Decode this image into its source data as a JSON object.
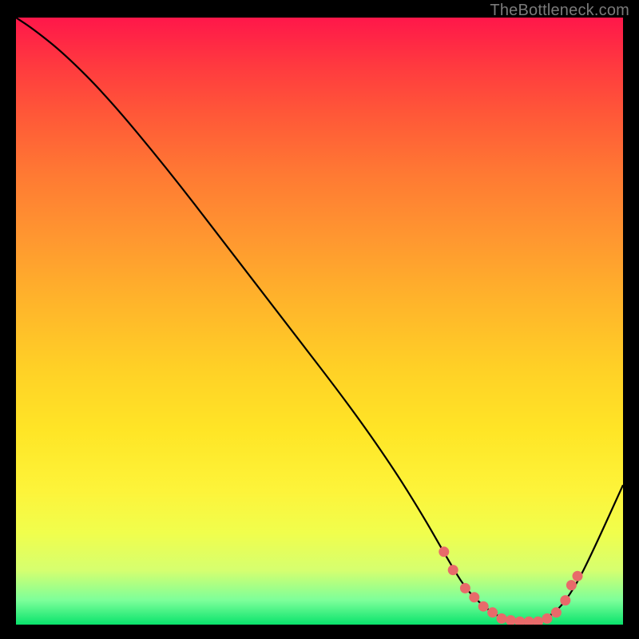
{
  "attribution": "TheBottleneck.com",
  "chart_data": {
    "type": "line",
    "title": "",
    "xlabel": "",
    "ylabel": "",
    "xlim": [
      0,
      100
    ],
    "ylim": [
      0,
      100
    ],
    "series": [
      {
        "name": "curve",
        "x": [
          0,
          3,
          8,
          15,
          25,
          35,
          45,
          55,
          62,
          67,
          71,
          74,
          77,
          80,
          83,
          86,
          89,
          92,
          95,
          100
        ],
        "y": [
          100,
          98,
          94,
          87,
          75,
          62,
          49,
          36,
          26,
          18,
          11,
          6,
          3,
          1,
          0.5,
          0.5,
          2,
          6,
          12,
          23
        ]
      }
    ],
    "markers": {
      "name": "highlighted-points",
      "color": "#e86a6a",
      "x": [
        70.5,
        72,
        74,
        75.5,
        77,
        78.5,
        80,
        81.5,
        83,
        84.5,
        86,
        87.5,
        89,
        90.5,
        91.5,
        92.5
      ],
      "y": [
        12,
        9,
        6,
        4.5,
        3,
        2,
        1,
        0.7,
        0.5,
        0.5,
        0.5,
        1,
        2,
        4,
        6.5,
        8
      ]
    }
  }
}
